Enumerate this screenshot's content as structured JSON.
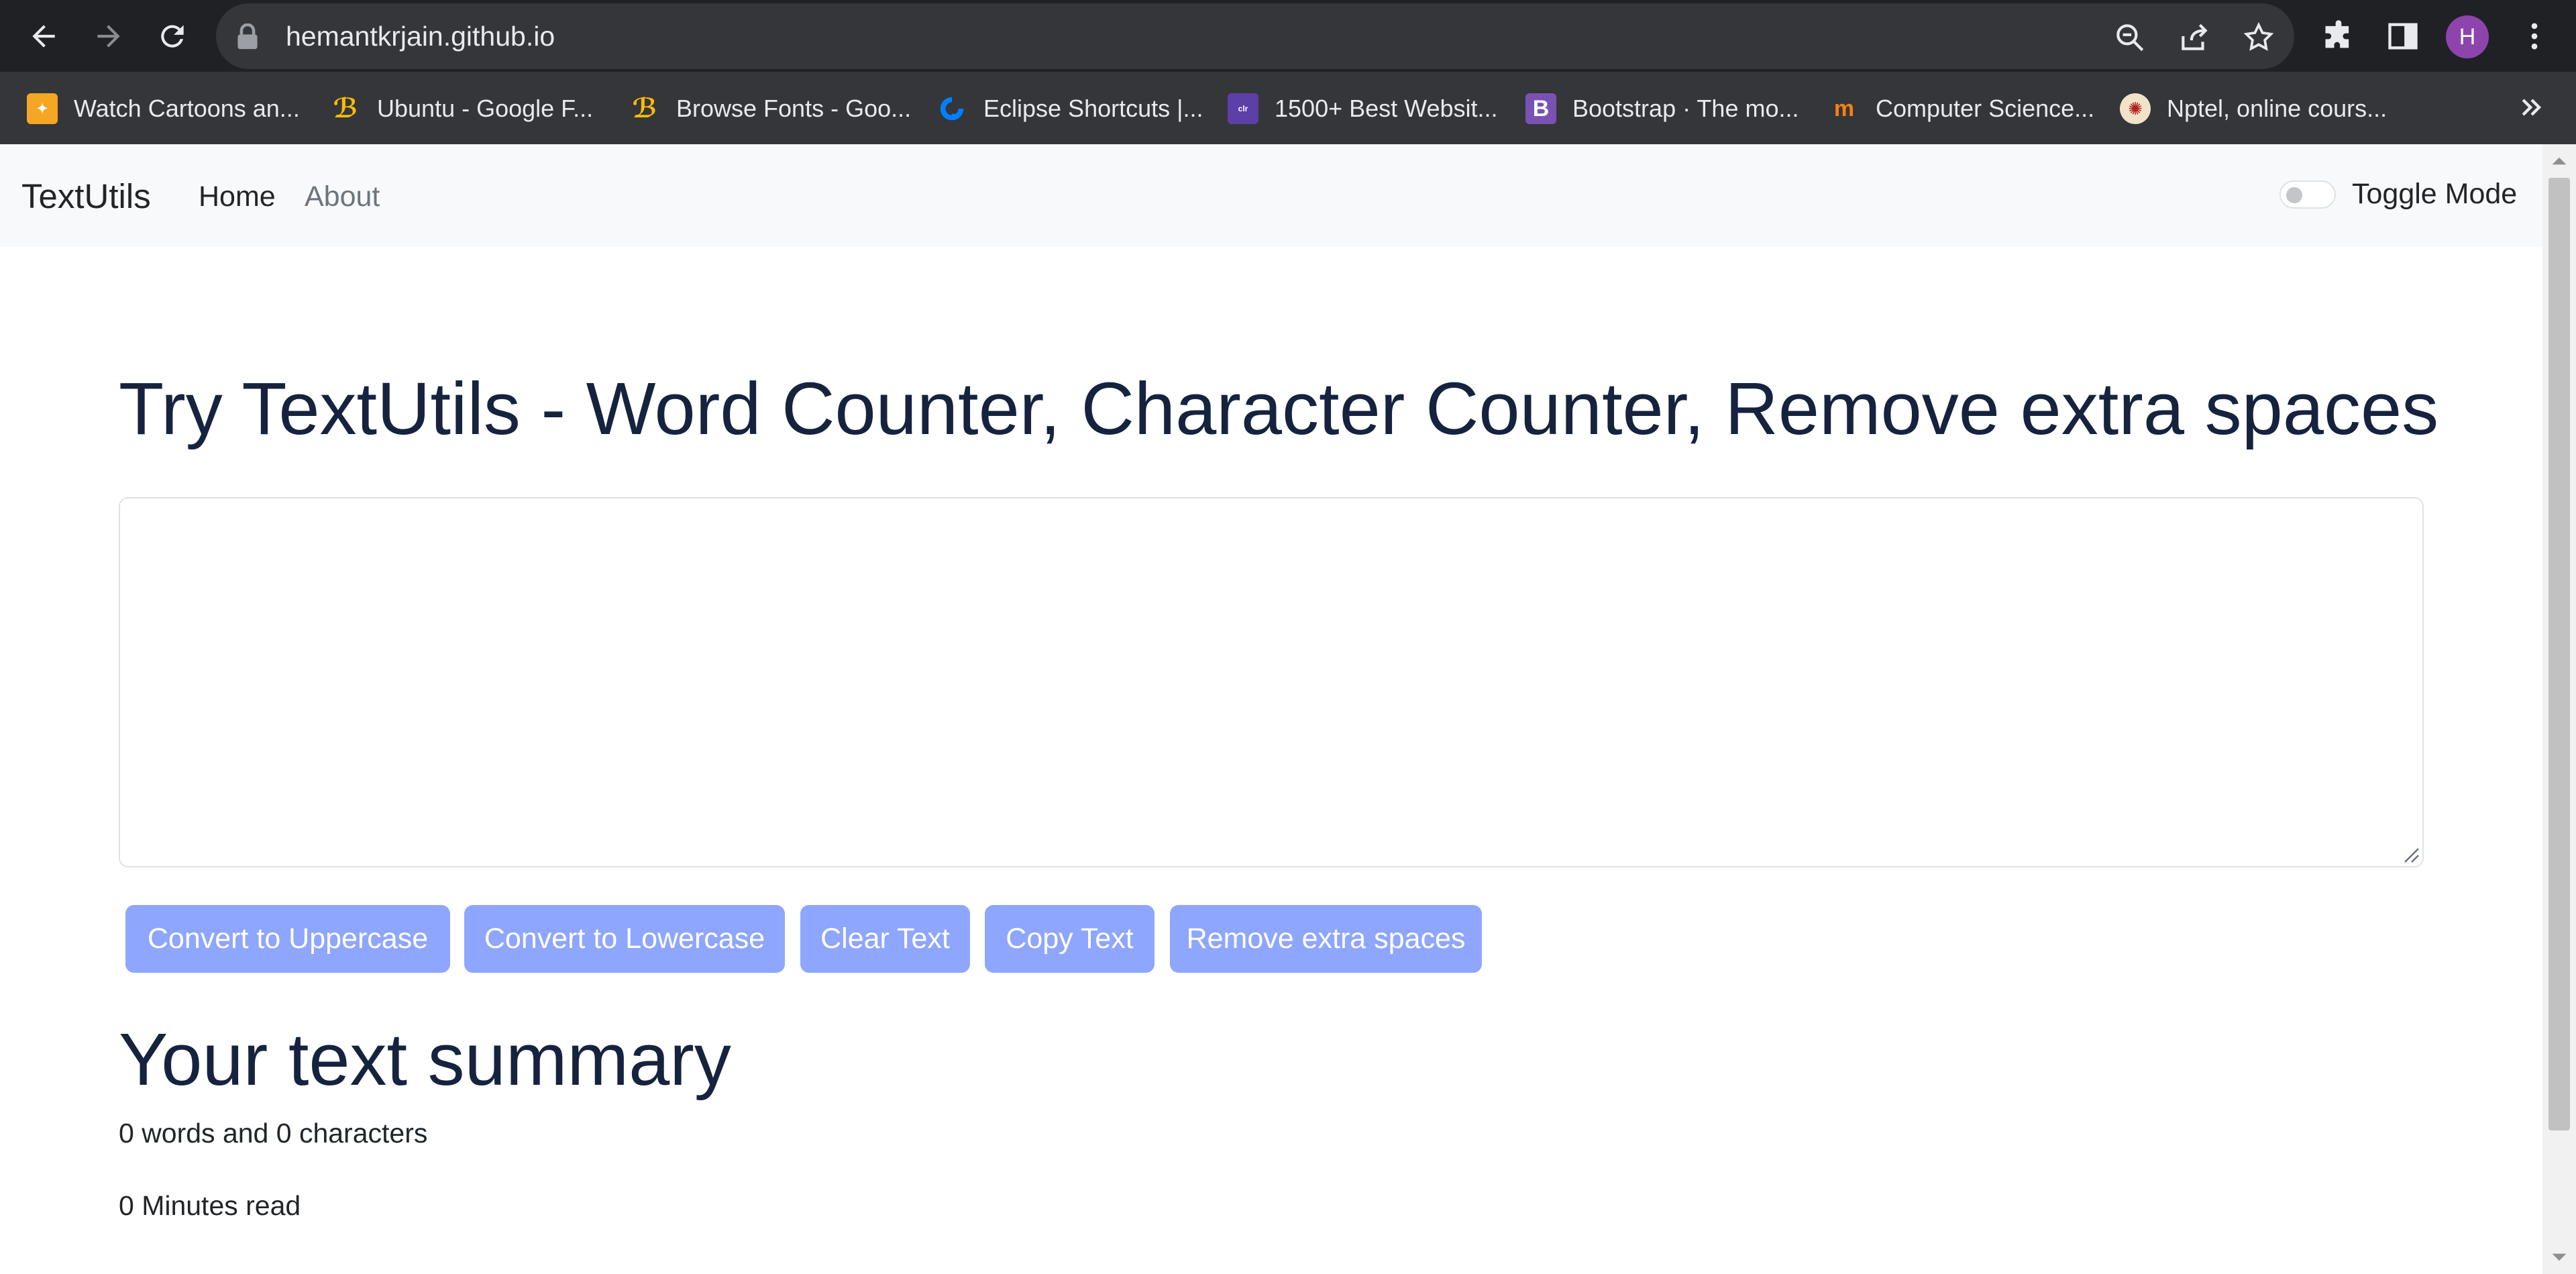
{
  "browser": {
    "url": "hemantkrjain.github.io",
    "profile_initial": "H",
    "icons": {
      "back": "back-arrow-icon",
      "forward": "forward-arrow-icon",
      "reload": "reload-icon",
      "lock": "lock-icon",
      "zoom": "zoom-out-icon",
      "share": "share-icon",
      "bookmark_star": "star-icon",
      "extensions": "puzzle-icon",
      "side_panel": "side-panel-icon",
      "menu": "kebab-menu-icon",
      "bookmarks_overflow": "chevron-double-right-icon"
    },
    "bookmarks": [
      {
        "label": "Watch Cartoons an...",
        "icon": "cartoon-site-favicon",
        "color": "#f5a623"
      },
      {
        "label": "Ubuntu - Google F...",
        "icon": "google-fonts-favicon",
        "color": "#34a853"
      },
      {
        "label": "Browse Fonts - Goo...",
        "icon": "google-fonts-favicon",
        "color": "#4285f4"
      },
      {
        "label": "Eclipse Shortcuts |...",
        "icon": "digitalocean-favicon",
        "color": "#0080ff"
      },
      {
        "label": "1500+ Best Websit...",
        "icon": "colorlib-favicon",
        "color": "#5d3fa8"
      },
      {
        "label": "Bootstrap · The mo...",
        "icon": "bootstrap-favicon",
        "color": "#7952b3"
      },
      {
        "label": "Computer Science...",
        "icon": "moodle-favicon",
        "color": "#f98012"
      },
      {
        "label": "Nptel, online cours...",
        "icon": "nptel-favicon",
        "color": "#b22222"
      }
    ]
  },
  "navbar": {
    "brand": "TextUtils",
    "links": [
      "Home",
      "About"
    ],
    "toggle_label": "Toggle Mode"
  },
  "main": {
    "heading": "Try TextUtils - Word Counter, Character Counter, Remove extra spaces",
    "textarea_value": "",
    "buttons": [
      "Convert to Uppercase",
      "Convert to Lowercase",
      "Clear Text",
      "Copy Text",
      "Remove extra spaces"
    ],
    "button_color": "#8ea6fd"
  },
  "summary": {
    "title": "Your text summary",
    "counts": "0 words and 0 characters",
    "read_time": "0 Minutes read"
  }
}
